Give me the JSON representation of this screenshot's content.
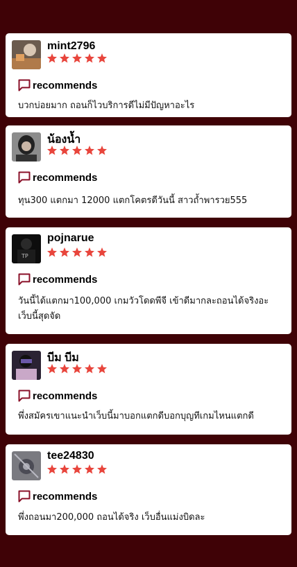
{
  "reviews": [
    {
      "username": "mint2796",
      "rating": 5,
      "recommend_label": "recommends",
      "text": "บวกบ่อยมาก ถอนก็ไวบริการดีไม่มีปัญหาอะไร",
      "avatar_icon": "user-photo-icon"
    },
    {
      "username": "น้องน้ำ",
      "rating": 5,
      "recommend_label": "recommends",
      "text": "ทุน300 แตกมา 12000 แตกโคตรดีวันนี้ สาวถ้ำพารวย555",
      "avatar_icon": "user-photo-icon"
    },
    {
      "username": "pojnarue",
      "rating": 5,
      "recommend_label": "recommends",
      "text": "วันนี้ได้แตกมา100,000 เกมวัวโดดพีจี เข้าดีมากละถอนได้จริงอะ เว็บนี้สุดจัด",
      "avatar_icon": "user-photo-icon"
    },
    {
      "username": "บีม บีม",
      "rating": 5,
      "recommend_label": "recommends",
      "text": "พึ่งสมัครเขาแนะนำเว็บนี้มาบอกแตกดีบอกบุญทีเกมไหนแตกดี",
      "avatar_icon": "user-photo-icon"
    },
    {
      "username": "tee24830",
      "rating": 5,
      "recommend_label": "recommends",
      "text": "พึ่งถอนมา200,000 ถอนได้จริง เว็บอื่นแม่งบิดละ",
      "avatar_icon": "user-photo-icon"
    }
  ],
  "colors": {
    "background": "#3f0206",
    "star": "#e8453c",
    "recommend_icon": "#8a1028"
  }
}
